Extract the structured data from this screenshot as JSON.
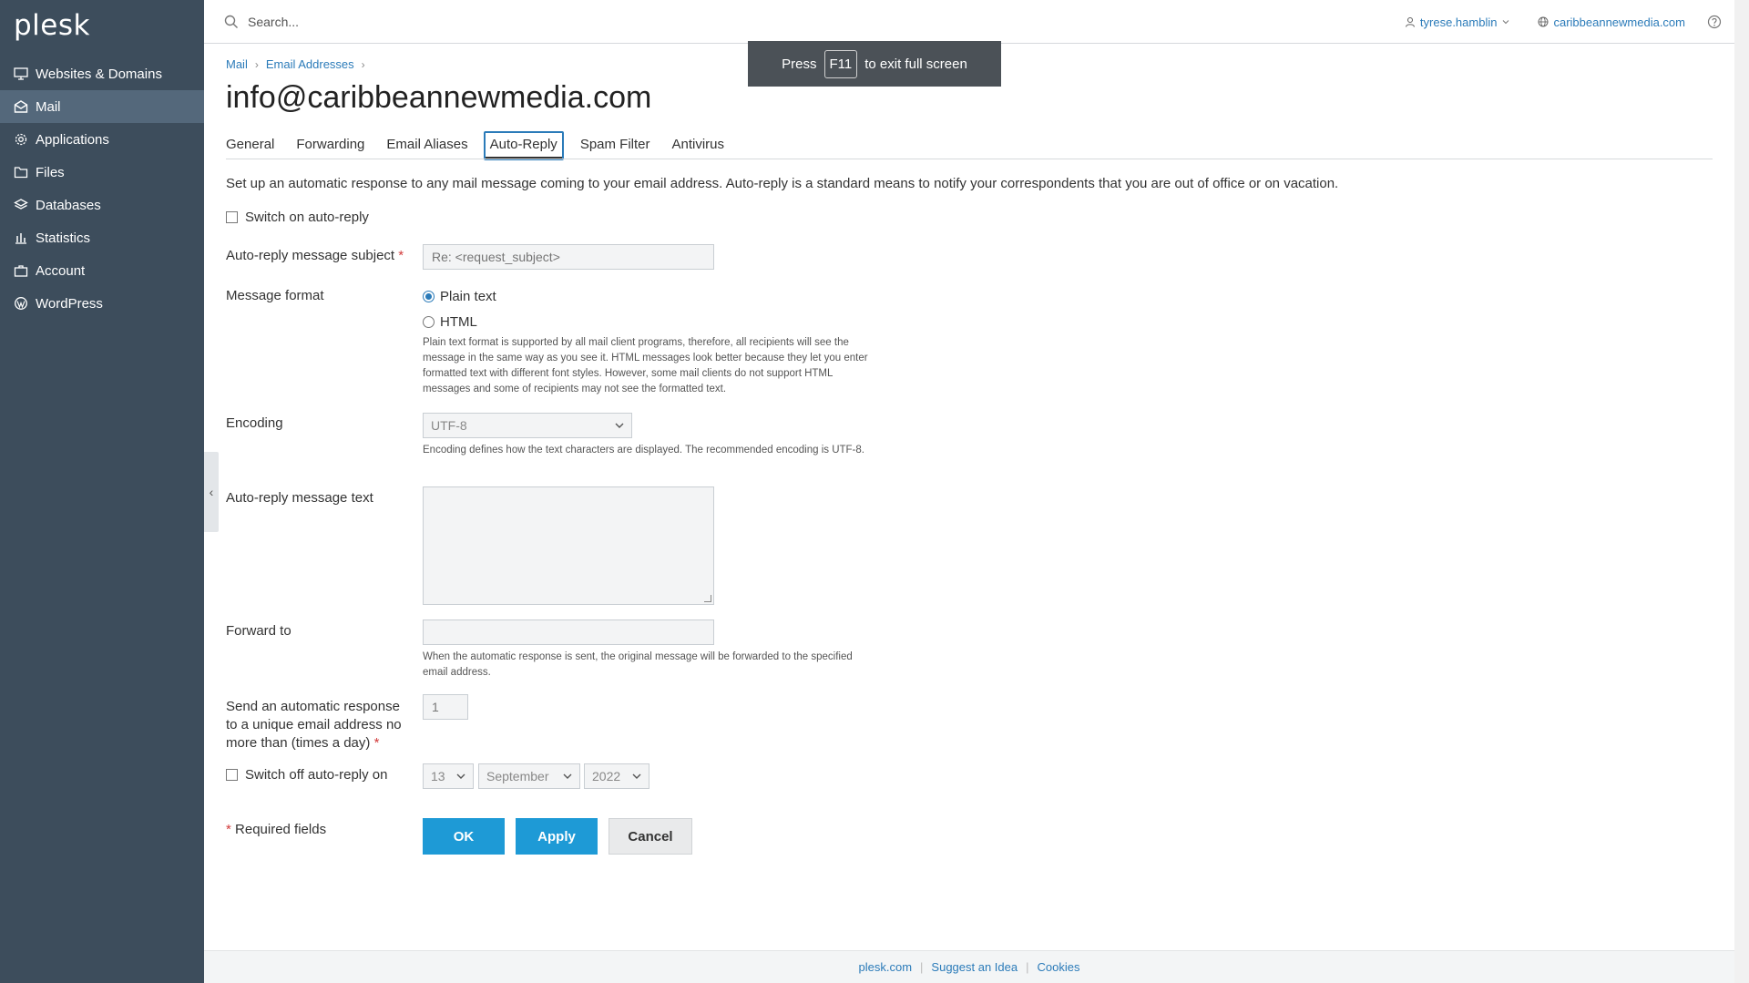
{
  "sidebar": {
    "logo": "plesk",
    "items": [
      {
        "label": "Websites & Domains",
        "icon": "monitor-icon"
      },
      {
        "label": "Mail",
        "icon": "mail-icon",
        "active": true
      },
      {
        "label": "Applications",
        "icon": "gear-icon"
      },
      {
        "label": "Files",
        "icon": "folder-icon"
      },
      {
        "label": "Databases",
        "icon": "layers-icon"
      },
      {
        "label": "Statistics",
        "icon": "bar-chart-icon"
      },
      {
        "label": "Account",
        "icon": "briefcase-icon"
      },
      {
        "label": "WordPress",
        "icon": "wordpress-icon"
      }
    ],
    "collapse_glyph": "‹"
  },
  "topbar": {
    "search_placeholder": "Search...",
    "user": "tyrese.hamblin",
    "subscription": "caribbeannewmedia.com"
  },
  "toast": {
    "before": "Press",
    "key": "F11",
    "after": "to exit full screen"
  },
  "breadcrumb": [
    "Mail",
    "Email Addresses"
  ],
  "page": {
    "title": "info@caribbeannewmedia.com",
    "tabs": [
      {
        "label": "General",
        "active": false
      },
      {
        "label": "Forwarding",
        "active": false
      },
      {
        "label": "Email Aliases",
        "active": false
      },
      {
        "label": "Auto-Reply",
        "active": true
      },
      {
        "label": "Spam Filter",
        "active": false
      },
      {
        "label": "Antivirus",
        "active": false
      }
    ],
    "intro": "Set up an automatic response to any mail message coming to your email address. Auto-reply is a standard means to notify your correspondents that you are out of office or on vacation."
  },
  "form": {
    "switch_on_label": "Switch on auto-reply",
    "switch_on_checked": false,
    "subject_label": "Auto-reply message subject",
    "subject_placeholder": "Re: <request_subject>",
    "format_label": "Message format",
    "format_options": [
      "Plain text",
      "HTML"
    ],
    "format_selected": "Plain text",
    "format_hint": "Plain text format is supported by all mail client programs, therefore, all recipients will see the message in the same way as you see it. HTML messages look better because they let you enter formatted text with different font styles. However, some mail clients do not support HTML messages and some of recipients may not see the formatted text.",
    "encoding_label": "Encoding",
    "encoding_value": "UTF-8",
    "encoding_hint": "Encoding defines how the text characters are displayed. The recommended encoding is UTF-8.",
    "message_label": "Auto-reply message text",
    "message_value": "",
    "forward_label": "Forward to",
    "forward_value": "",
    "forward_hint": "When the automatic response is sent, the original message will be forwarded to the specified email address.",
    "frequency_label": "Send an automatic response to a unique email address no more than (times a day)",
    "frequency_value": "1",
    "switch_off_label": "Switch off auto-reply on",
    "switch_off_checked": false,
    "off_day": "13",
    "off_month": "September",
    "off_year": "2022",
    "required_note": "Required fields",
    "required_mark": "*",
    "ok_label": "OK",
    "apply_label": "Apply",
    "cancel_label": "Cancel"
  },
  "footer": {
    "links": [
      "plesk.com",
      "Suggest an Idea",
      "Cookies"
    ]
  },
  "colors": {
    "sidebar_bg": "#3d4d5c",
    "sidebar_active": "#54687b",
    "link": "#2b7bb9",
    "primary_button": "#1e9ad6",
    "required": "#d23b3b"
  }
}
